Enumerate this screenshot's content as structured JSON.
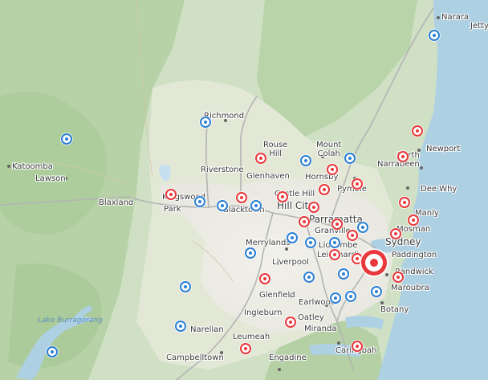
{
  "colors": {
    "red": "#e8383b",
    "blue": "#2b7fd4"
  },
  "labels": {
    "narara": "Narara",
    "jetty": "Jetty",
    "richmond": "Richmond",
    "katoomba": "Katoomba",
    "lawson": "Lawson",
    "rouse_hill": "Rouse\nHill",
    "mount_colah": "Mount\nColah",
    "newport": "Newport",
    "north_narrabeen": "North\nNarrabeen",
    "riverstone": "Riverstone",
    "glenhaven": "Glenhaven",
    "hornsby": "Hornsby",
    "pymble": "Pymble",
    "dee_why": "Dee Why",
    "blaxland": "Blaxland",
    "kingswood": "Kingswood",
    "park": "Park",
    "castle_hill": "Castle Hill",
    "blacktown": "Blacktown",
    "hill_city": "Hill City",
    "manly": "Manly",
    "parramatta": "Parramatta",
    "mosman": "Mosman",
    "granville": "Granville",
    "sydney": "Sydney",
    "merrylands": "Merrylands",
    "lidcombe": "Lidcombe",
    "paddington": "Paddington",
    "leichhardt": "Leichhardt",
    "liverpool": "Liverpool",
    "randwick": "Randwick",
    "maroubra": "Maroubra",
    "glenfield": "Glenfield",
    "earlwood": "Earlwood",
    "ingleburn": "Ingleburn",
    "botany": "Botany",
    "oatley": "Oatley",
    "narellan": "Narellan",
    "miranda": "Miranda",
    "leumeah": "Leumeah",
    "caringbah": "Caringbah",
    "campbelltown": "Campbelltown",
    "engadine": "Engadine",
    "lake_burragorang": "Lake Burragorang"
  },
  "markers": [
    {
      "color": "blue",
      "size": "small",
      "label": "",
      "near": "Narara"
    },
    {
      "color": "blue",
      "size": "small",
      "label": "",
      "near": "Richmond"
    },
    {
      "color": "blue",
      "size": "small",
      "label": "",
      "near": "Katoomba"
    },
    {
      "color": "red",
      "size": "small",
      "label": "",
      "near": "Newport"
    },
    {
      "color": "red",
      "size": "small",
      "label": "",
      "near": "Rouse Hill"
    },
    {
      "color": "blue",
      "size": "small",
      "label": "",
      "near": "Glenhaven"
    },
    {
      "color": "blue",
      "size": "small",
      "label": "",
      "near": "Mount Colah"
    },
    {
      "color": "red",
      "size": "small",
      "label": "",
      "near": "Hornsby"
    },
    {
      "color": "red",
      "size": "small",
      "label": "",
      "near": "North Narrabeen"
    },
    {
      "color": "red",
      "size": "small",
      "label": "",
      "near": "Pymble"
    },
    {
      "color": "red",
      "size": "small",
      "label": "",
      "near": "Pymble"
    },
    {
      "color": "red",
      "size": "small",
      "label": "",
      "near": "Kingswood"
    },
    {
      "color": "blue",
      "size": "small",
      "label": "",
      "near": "Kingswood"
    },
    {
      "color": "blue",
      "size": "small",
      "label": "",
      "near": "Blacktown"
    },
    {
      "color": "red",
      "size": "small",
      "label": "",
      "near": "Blacktown"
    },
    {
      "color": "blue",
      "size": "small",
      "label": "",
      "near": "Blacktown"
    },
    {
      "color": "red",
      "size": "small",
      "label": "",
      "near": "Castle Hill"
    },
    {
      "color": "red",
      "size": "small",
      "label": "",
      "near": "Hill City"
    },
    {
      "color": "red",
      "size": "small",
      "label": "",
      "near": "Dee Why"
    },
    {
      "color": "red",
      "size": "small",
      "label": "",
      "near": "Manly"
    },
    {
      "color": "red",
      "size": "small",
      "label": "",
      "near": "Parramatta"
    },
    {
      "color": "red",
      "size": "small",
      "label": "",
      "near": "Parramatta"
    },
    {
      "color": "red",
      "size": "small",
      "label": "",
      "near": "Mosman"
    },
    {
      "color": "red",
      "size": "small",
      "label": "",
      "near": "Mosman"
    },
    {
      "color": "blue",
      "size": "small",
      "label": "",
      "near": "Parramatta"
    },
    {
      "color": "blue",
      "size": "small",
      "label": "",
      "near": "Merrylands"
    },
    {
      "color": "blue",
      "size": "small",
      "label": "",
      "near": "Lidcombe"
    },
    {
      "color": "blue",
      "size": "small",
      "label": "",
      "near": "Lidcombe"
    },
    {
      "color": "blue",
      "size": "small",
      "label": "",
      "near": "Merrylands"
    },
    {
      "color": "red",
      "size": "small",
      "label": "",
      "near": "Sydney"
    },
    {
      "color": "red",
      "size": "small",
      "label": "",
      "near": "Sydney"
    },
    {
      "color": "red",
      "size": "large",
      "label": "",
      "near": "Sydney"
    },
    {
      "color": "red",
      "size": "small",
      "label": "",
      "near": "Liverpool"
    },
    {
      "color": "blue",
      "size": "small",
      "label": "",
      "near": "Leichhardt"
    },
    {
      "color": "blue",
      "size": "small",
      "label": "",
      "near": "Leichhardt"
    },
    {
      "color": "red",
      "size": "small",
      "label": "",
      "near": "Randwick"
    },
    {
      "color": "blue",
      "size": "small",
      "label": "",
      "near": "Earlwood"
    },
    {
      "color": "blue",
      "size": "small",
      "label": "",
      "near": "Earlwood"
    },
    {
      "color": "blue",
      "size": "small",
      "label": "",
      "near": "Botany"
    },
    {
      "color": "blue",
      "size": "small",
      "label": "",
      "near": "Glenfield"
    },
    {
      "color": "red",
      "size": "small",
      "label": "",
      "near": "Oatley"
    },
    {
      "color": "blue",
      "size": "small",
      "label": "",
      "near": "Narellan"
    },
    {
      "color": "red",
      "size": "small",
      "label": "",
      "near": "Leumeah"
    },
    {
      "color": "red",
      "size": "small",
      "label": "",
      "near": "Caringbah"
    },
    {
      "color": "blue",
      "size": "small",
      "label": "",
      "near": "Lake Burragorang"
    }
  ]
}
